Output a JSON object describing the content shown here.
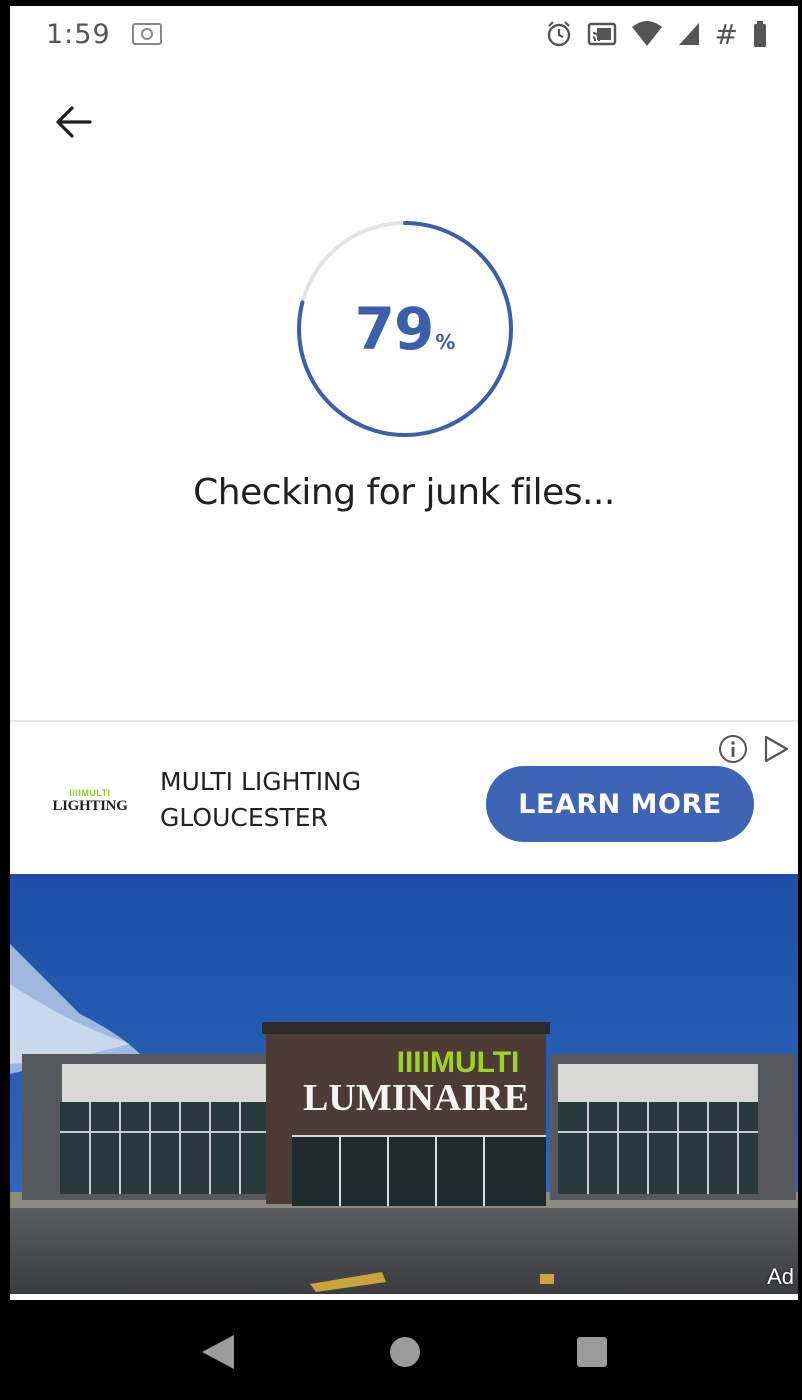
{
  "status_bar": {
    "time": "1:59",
    "icons": [
      "screenshot-icon",
      "alarm-icon",
      "cast-icon",
      "wifi-icon",
      "signal-icon",
      "hash-icon",
      "battery-icon"
    ],
    "hash_symbol": "#"
  },
  "scan": {
    "progress_percent": 79,
    "progress_value": "79",
    "progress_unit": "%",
    "status_text": "Checking for junk files...",
    "accent_color": "#3b5fad",
    "track_color": "#e3e3e3"
  },
  "ad": {
    "logo_top": "IIIIMULTI",
    "logo_bottom": "LIGHTING",
    "advertiser_line1": "MULTI LIGHTING",
    "advertiser_line2": "GLOUCESTER",
    "cta_label": "LEARN MORE",
    "cta_color": "#3d64b5",
    "storefront_sign_top": "IIIIMULTI",
    "storefront_sign_bottom": "LUMINAIRE",
    "badge": "Ad"
  },
  "nav_bar": {
    "buttons": [
      "back-icon",
      "home-icon",
      "recents-icon"
    ]
  }
}
